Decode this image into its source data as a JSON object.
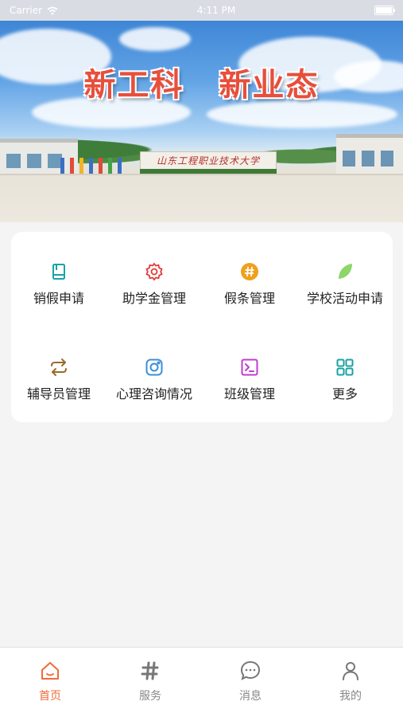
{
  "status_bar": {
    "carrier": "Carrier",
    "time": "4:11 PM"
  },
  "banner": {
    "slogan_left": "新工科",
    "slogan_right": "新业态",
    "sign_text": "山东工程职业技术大学"
  },
  "services": [
    {
      "label": "销假申请",
      "icon": "book-icon",
      "color": "#1aa2a6"
    },
    {
      "label": "助学金管理",
      "icon": "gear-icon",
      "color": "#e23a3a"
    },
    {
      "label": "假条管理",
      "icon": "hashtag-badge-icon",
      "color": "#f0a01c"
    },
    {
      "label": "学校活动申请",
      "icon": "leaf-icon",
      "color": "#8dd66a"
    },
    {
      "label": "辅导员管理",
      "icon": "swap-arrows-icon",
      "color": "#9a6a2a"
    },
    {
      "label": "心理咨询情况",
      "icon": "instagram-icon",
      "color": "#3b8fd8"
    },
    {
      "label": "班级管理",
      "icon": "terminal-icon",
      "color": "#c03bd1"
    },
    {
      "label": "更多",
      "icon": "grid-icon",
      "color": "#1aa2a6"
    }
  ],
  "tabs": [
    {
      "label": "首页",
      "icon": "home-icon",
      "active": true
    },
    {
      "label": "服务",
      "icon": "hashtag-icon",
      "active": false
    },
    {
      "label": "消息",
      "icon": "chat-bubble-icon",
      "active": false
    },
    {
      "label": "我的",
      "icon": "user-icon",
      "active": false
    }
  ],
  "colors": {
    "accent": "#ef6b3a",
    "inactive": "#888888",
    "background": "#f4f4f4"
  }
}
